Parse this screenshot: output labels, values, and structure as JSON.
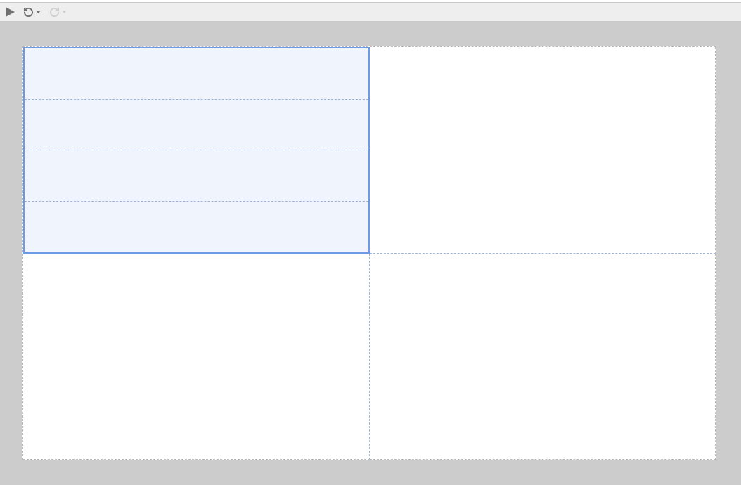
{
  "toolbar": [
    {
      "kind": "play",
      "disabled": false
    },
    {
      "kind": "undo",
      "disabled": false
    },
    {
      "kind": "redo",
      "disabled": true
    }
  ],
  "grid": {
    "cells": [
      {
        "selected": true,
        "children": [
          {
            "kind": "row"
          },
          {
            "kind": "row"
          },
          {
            "kind": "row"
          },
          {
            "kind": "row"
          }
        ]
      },
      {
        "selected": false
      },
      {
        "selected": false
      },
      {
        "selected": false
      }
    ]
  }
}
